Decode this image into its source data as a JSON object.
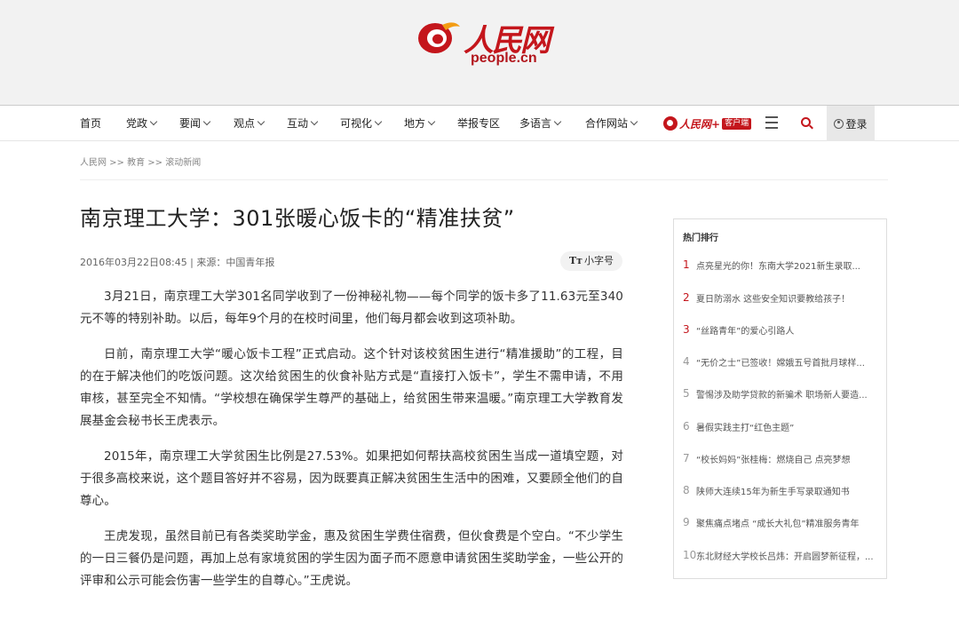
{
  "header": {
    "logo_cn": "人民网",
    "logo_en": "people.cn",
    "brand_color": "#c4161c"
  },
  "nav": {
    "items": [
      {
        "label": "首页",
        "dropdown": false
      },
      {
        "label": "党政",
        "dropdown": true
      },
      {
        "label": "要闻",
        "dropdown": true
      },
      {
        "label": "观点",
        "dropdown": true
      },
      {
        "label": "互动",
        "dropdown": true
      },
      {
        "label": "可视化",
        "dropdown": true
      },
      {
        "label": "地方",
        "dropdown": true
      },
      {
        "label": "举报专区",
        "dropdown": false
      },
      {
        "label": "多语言",
        "dropdown": true
      },
      {
        "label": "合作网站",
        "dropdown": true
      }
    ],
    "app_name": "人民网+",
    "app_badge": "客户端",
    "login_label": "登录"
  },
  "breadcrumb": "人民网 >> 教育 >> 滚动新闻",
  "article": {
    "title": "南京理工大学：301张暖心饭卡的“精准扶贫”",
    "meta": "2016年03月22日08:45 | 来源：中国青年报",
    "font_toggle_label": "小字号",
    "paragraphs": [
      "3月21日，南京理工大学301名同学收到了一份神秘礼物——每个同学的饭卡多了11.63元至340元不等的特别补助。以后，每年9个月的在校时间里，他们每月都会收到这项补助。",
      "日前，南京理工大学“暖心饭卡工程”正式启动。这个针对该校贫困生进行“精准援助”的工程，目的在于解决他们的吃饭问题。这次给贫困生的伙食补贴方式是“直接打入饭卡”，学生不需申请，不用审核，甚至完全不知情。“学校想在确保学生尊严的基础上，给贫困生带来温暖。”南京理工大学教育发展基金会秘书长王虎表示。",
      "2015年，南京理工大学贫困生比例是27.53%。如果把如何帮扶高校贫困生当成一道填空题，对于很多高校来说，这个题目答好并不容易，因为既要真正解决贫困生生活中的困难，又要顾全他们的自尊心。",
      "王虎发现，虽然目前已有各类奖助学金，惠及贫困生学费住宿费，但伙食费是个空白。“不少学生的一日三餐仍是问题，再加上总有家境贫困的学生因为面子而不愿意申请贫困生奖助学金，一些公开的评审和公示可能会伤害一些学生的自尊心。”王虎说。"
    ]
  },
  "hot": {
    "title": "热门排行",
    "items": [
      {
        "rank": "1",
        "text": "点亮星光的你！东南大学2021新生录取..."
      },
      {
        "rank": "2",
        "text": "夏日防溺水 这些安全知识要教给孩子！"
      },
      {
        "rank": "3",
        "text": "“丝路青年”的爱心引路人"
      },
      {
        "rank": "4",
        "text": "“无价之士”已签收！嫦娥五号首批月球样..."
      },
      {
        "rank": "5",
        "text": "警惕涉及助学贷款的新骗术 职场新人要造..."
      },
      {
        "rank": "6",
        "text": "暑假实践主打“红色主题”"
      },
      {
        "rank": "7",
        "text": "“校长妈妈”张桂梅：燃烧自己 点亮梦想"
      },
      {
        "rank": "8",
        "text": "陕师大连续15年为新生手写录取通知书"
      },
      {
        "rank": "9",
        "text": "聚焦痛点堵点 “成长大礼包”精准服务青年"
      },
      {
        "rank": "10",
        "text": "东北财经大学校长吕炜：开启圆梦新征程，..."
      }
    ]
  }
}
